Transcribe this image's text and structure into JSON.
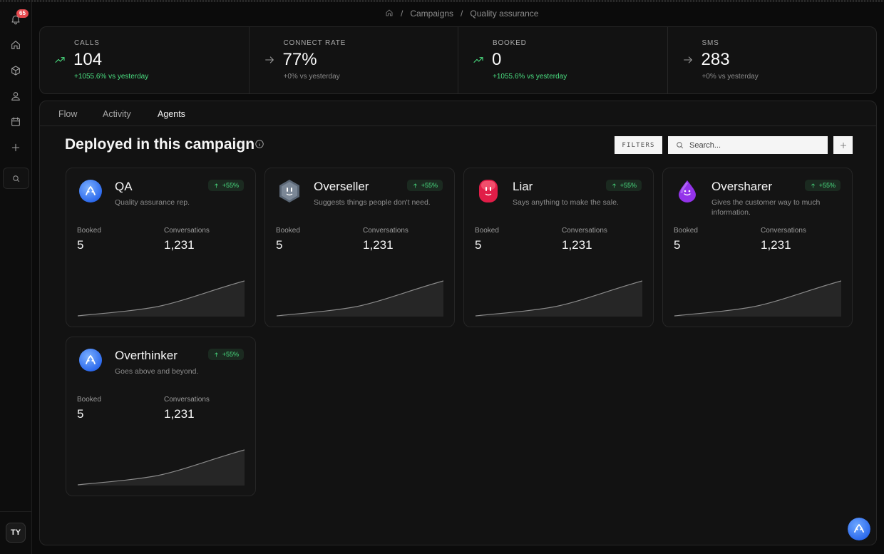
{
  "sidebar": {
    "notification_count": "65",
    "user_initials": "TY",
    "icons": [
      "bell-icon",
      "home-icon",
      "cube-icon",
      "user-icon",
      "calendar-icon",
      "plus-icon",
      "search-icon"
    ]
  },
  "breadcrumb": {
    "items": [
      "Campaigns",
      "Quality assurance"
    ],
    "separator": "/"
  },
  "stats": [
    {
      "label": "CALLS",
      "value": "104",
      "delta": "+1055.6% vs yesterday",
      "trend": "up"
    },
    {
      "label": "CONNECT RATE",
      "value": "77%",
      "delta": "+0% vs yesterday",
      "trend": "flat"
    },
    {
      "label": "BOOKED",
      "value": "0",
      "delta": "+1055.6% vs yesterday",
      "trend": "up"
    },
    {
      "label": "SMS",
      "value": "283",
      "delta": "+0% vs yesterday",
      "trend": "flat"
    }
  ],
  "tabs": [
    {
      "label": "Flow",
      "active": false
    },
    {
      "label": "Activity",
      "active": false
    },
    {
      "label": "Agents",
      "active": true
    }
  ],
  "section": {
    "title": "Deployed in this campaign",
    "filters_label": "FILTERS",
    "search_placeholder": "Search..."
  },
  "agents": [
    {
      "name": "QA",
      "description": "Quality assurance rep.",
      "change": "+55%",
      "booked_label": "Booked",
      "booked": "5",
      "conversations_label": "Conversations",
      "conversations": "1,231",
      "icon": "blue-face-icon"
    },
    {
      "name": "Overseller",
      "description": "Suggests things people don't need.",
      "change": "+55%",
      "booked_label": "Booked",
      "booked": "5",
      "conversations_label": "Conversations",
      "conversations": "1,231",
      "icon": "gray-hexagon-face-icon"
    },
    {
      "name": "Liar",
      "description": "Says anything to make the sale.",
      "change": "+55%",
      "booked_label": "Booked",
      "booked": "5",
      "conversations_label": "Conversations",
      "conversations": "1,231",
      "icon": "red-face-icon"
    },
    {
      "name": "Oversharer",
      "description": "Gives the customer way to much information.",
      "change": "+55%",
      "booked_label": "Booked",
      "booked": "5",
      "conversations_label": "Conversations",
      "conversations": "1,231",
      "icon": "purple-drop-face-icon"
    },
    {
      "name": "Overthinker",
      "description": "Goes above and beyond.",
      "change": "+55%",
      "booked_label": "Booked",
      "booked": "5",
      "conversations_label": "Conversations",
      "conversations": "1,231",
      "icon": "blue-face-icon"
    }
  ],
  "colors": {
    "positive": "#4ade80",
    "background": "#0b0b0b",
    "panel": "#121212",
    "qa_blue": "#3b82f6",
    "liar_red": "#e11d48",
    "oversharer_purple": "#9333ea",
    "overseller_gray": "#64748b"
  }
}
